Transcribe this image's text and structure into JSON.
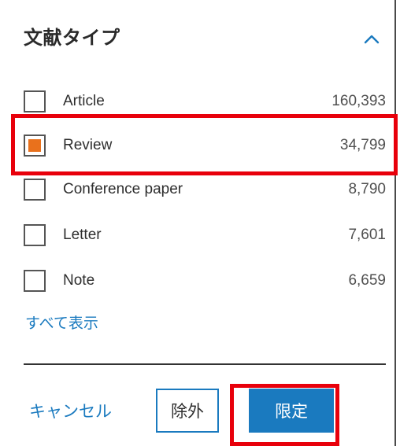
{
  "facet": {
    "title": "文献タイプ",
    "collapse_icon": "chevron-up-icon",
    "items": [
      {
        "label": "Article",
        "count": "160,393",
        "checked": false
      },
      {
        "label": "Review",
        "count": "34,799",
        "checked": true
      },
      {
        "label": "Conference paper",
        "count": "8,790",
        "checked": false
      },
      {
        "label": "Letter",
        "count": "7,601",
        "checked": false
      },
      {
        "label": "Note",
        "count": "6,659",
        "checked": false
      }
    ],
    "show_all": "すべて表示"
  },
  "actions": {
    "cancel": "キャンセル",
    "exclude": "除外",
    "limit": "限定"
  },
  "colors": {
    "accent": "#1a7abf",
    "checked_fill": "#e9711c",
    "highlight": "#e8000b"
  }
}
